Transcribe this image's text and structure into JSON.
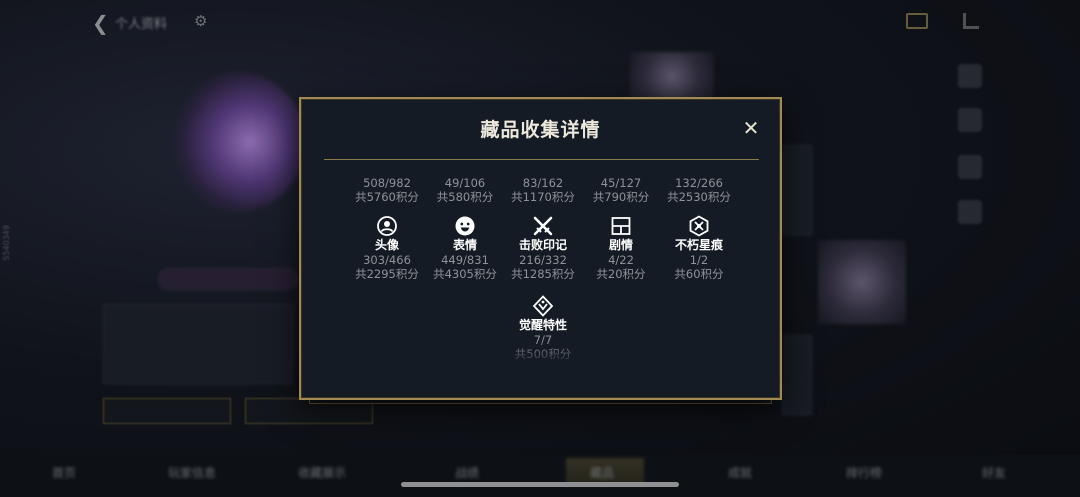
{
  "background": {
    "title": "个人资料",
    "bottom_tabs": [
      "首页",
      "玩家信息",
      "收藏展示",
      "战绩",
      "藏品",
      "成就",
      "排行榜",
      "好友"
    ]
  },
  "modal": {
    "title": "藏品收集详情",
    "close_icon": "close-icon",
    "top_row": [
      {
        "progress": "508/982",
        "points": "共5760积分"
      },
      {
        "progress": "49/106",
        "points": "共580积分"
      },
      {
        "progress": "83/162",
        "points": "共1170积分"
      },
      {
        "progress": "45/127",
        "points": "共790积分"
      },
      {
        "progress": "132/266",
        "points": "共2530积分"
      }
    ],
    "categories": [
      {
        "icon": "avatar-icon",
        "label": "头像",
        "progress": "303/466",
        "points": "共2295积分"
      },
      {
        "icon": "emoji-icon",
        "label": "表情",
        "progress": "449/831",
        "points": "共4305积分"
      },
      {
        "icon": "crossed-swords-icon",
        "label": "击败印记",
        "progress": "216/332",
        "points": "共1285积分"
      },
      {
        "icon": "panel-icon",
        "label": "剧情",
        "progress": "4/22",
        "points": "共20积分"
      },
      {
        "icon": "star-scar-icon",
        "label": "不朽星痕",
        "progress": "1/2",
        "points": "共60积分"
      },
      {
        "icon": "awaken-icon",
        "label": "觉醒特性",
        "progress": "7/7",
        "points": "共500积分"
      }
    ]
  },
  "colors": {
    "gold_border": "#a28b52",
    "modal_bg": "#151b24",
    "muted_text": "#8e9397",
    "label_text": "#ffffff"
  }
}
